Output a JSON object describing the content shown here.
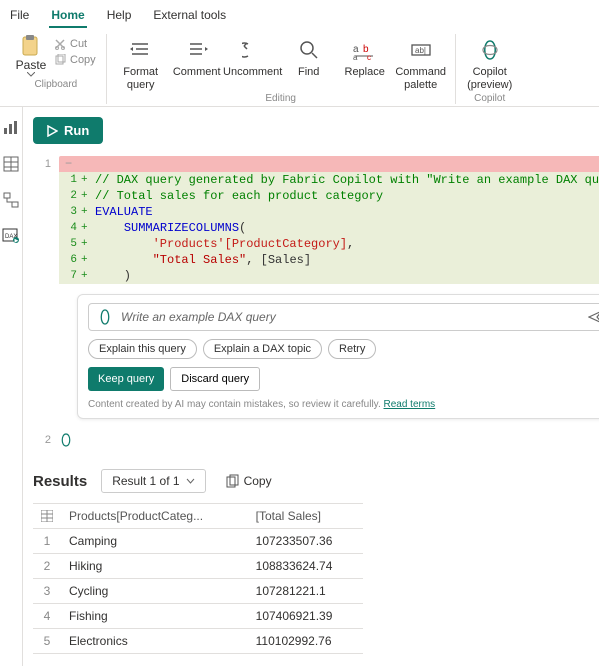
{
  "menu": {
    "file": "File",
    "home": "Home",
    "help": "Help",
    "external": "External tools"
  },
  "ribbon": {
    "paste": "Paste",
    "cut": "Cut",
    "copy": "Copy",
    "clipboard_group": "Clipboard",
    "format_query": "Format query",
    "comment": "Comment",
    "uncomment": "Uncomment",
    "find": "Find",
    "replace": "Replace",
    "command_palette": "Command palette",
    "editing_group": "Editing",
    "copilot": "Copilot (preview)",
    "copilot_group": "Copilot"
  },
  "run_label": "Run",
  "editor": {
    "outer_line": "1",
    "lines": [
      {
        "n": "1",
        "html": "<span class='cm-comment'>// DAX query generated by Fabric Copilot with \"Write an example DAX query\"</span>"
      },
      {
        "n": "2",
        "html": "<span class='cm-comment'>// Total sales for each product category</span>"
      },
      {
        "n": "3",
        "html": "<span class='cm-keyword'>EVALUATE</span>"
      },
      {
        "n": "4",
        "html": "    <span class='cm-func'>SUMMARIZECOLUMNS</span>("
      },
      {
        "n": "5",
        "html": "        <span class='cm-col'>'Products'[ProductCategory]</span>,"
      },
      {
        "n": "6",
        "html": "        <span class='cm-str'>\"Total Sales\"</span>, <span class='cm-meas'>[Sales]</span>"
      },
      {
        "n": "7",
        "html": "    )"
      }
    ]
  },
  "copilot_panel": {
    "input_value": "Write an example DAX query",
    "chips": {
      "explain_query": "Explain this query",
      "explain_topic": "Explain a DAX topic",
      "retry": "Retry"
    },
    "keep": "Keep query",
    "discard": "Discard query",
    "disclaimer_text": "Content created by AI may contain mistakes, so review it carefully. ",
    "disclaimer_link": "Read terms"
  },
  "line2": "2",
  "results": {
    "title": "Results",
    "dropdown": "Result 1 of 1",
    "copy": "Copy",
    "columns": {
      "c1": "Products[ProductCateg...",
      "c2": "[Total Sales]"
    },
    "rows": [
      {
        "n": "1",
        "cat": "Camping",
        "val": "107233507.36"
      },
      {
        "n": "2",
        "cat": "Hiking",
        "val": "108833624.74"
      },
      {
        "n": "3",
        "cat": "Cycling",
        "val": "107281221.1"
      },
      {
        "n": "4",
        "cat": "Fishing",
        "val": "107406921.39"
      },
      {
        "n": "5",
        "cat": "Electronics",
        "val": "110102992.76"
      }
    ]
  }
}
